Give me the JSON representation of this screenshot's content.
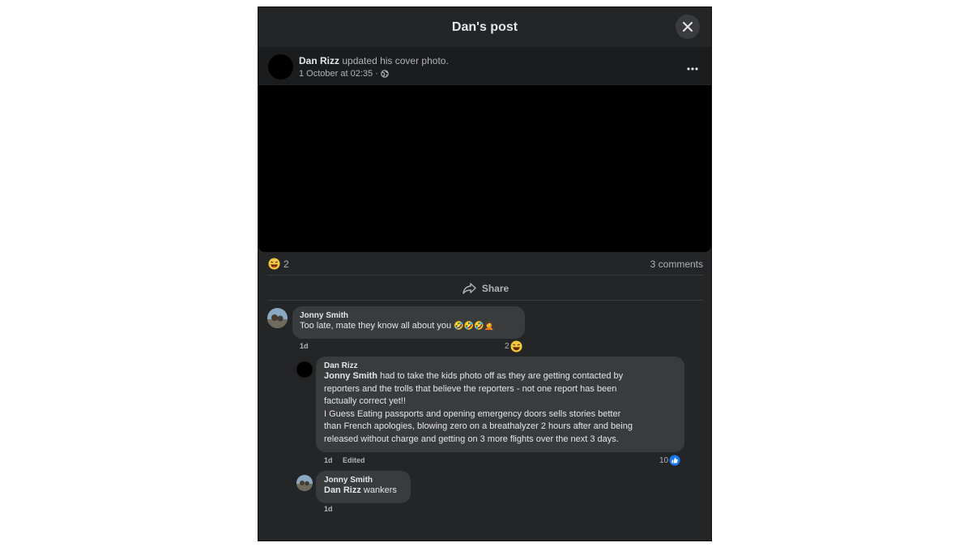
{
  "modal": {
    "title": "Dan's post"
  },
  "post": {
    "author": "Dan Rizz",
    "action": "updated his cover photo.",
    "timestamp": "1 October at 02:35",
    "separator": "·",
    "reaction_count": "2",
    "comments_count": "3 comments",
    "share_label": "Share"
  },
  "comments": [
    {
      "author": "Jonny Smith",
      "text": "Too late, mate they know all about you",
      "emojis": "🤣🤣🤣🤦",
      "time": "1d",
      "reaction_count": "2"
    },
    {
      "author": "Dan Rizz",
      "mention": "Jonny Smith",
      "lines": [
        " had to take the kids photo off as they are getting contacted by",
        "reporters and the trolls that believe the reporters - not one report has been",
        "factually correct yet!!",
        "I Guess Eating passports and opening emergency doors sells stories better",
        "than French apologies, blowing zero on a breathalyzer 2 hours after and being",
        "released without charge and getting on 3 more flights over the next 3 days."
      ],
      "time": "1d",
      "edited": "Edited",
      "reaction_count": "10"
    },
    {
      "author": "Jonny Smith",
      "mention": "Dan Rizz",
      "text": " wankers",
      "time": "1d"
    }
  ],
  "icons": {
    "close": "close-icon",
    "more": "more-icon",
    "globe": "globe-icon",
    "share": "share-icon",
    "haha": "haha-icon",
    "like": "like-icon"
  },
  "colors": {
    "modal_bg": "#242526",
    "bubble_bg": "#3a3b3c",
    "text": "#e4e6eb",
    "muted": "#b0b3b8",
    "like_blue": "#1877f2"
  }
}
